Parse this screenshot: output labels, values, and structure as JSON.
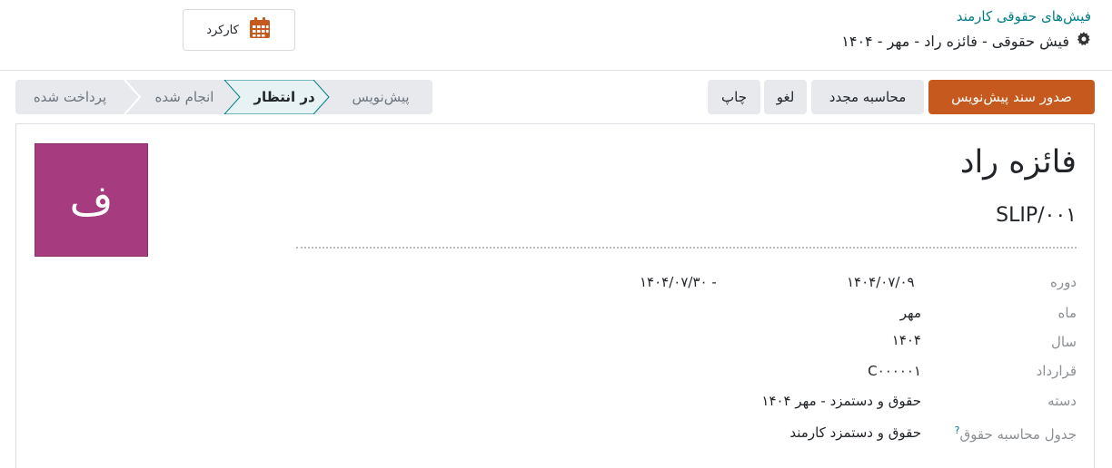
{
  "header": {
    "breadcrumb": "فیش‌های حقوقی کارمند",
    "title": "فیش حقوقی - فائزه راد - مهر - ۱۴۰۴",
    "gear_icon": "gear-icon",
    "worked_days_button": {
      "label": "کارکرد",
      "icon": "calendar-icon",
      "icon_color": "#c65a1e"
    }
  },
  "actions": {
    "create_draft_entry": "صدور سند پیش‌نویس",
    "recompute": "محاسبه مجدد",
    "cancel": "لغو",
    "print": "چاپ"
  },
  "status": {
    "steps": [
      "پیش‌نویس",
      "در انتظار",
      "انجام شده",
      "پرداخت شده"
    ],
    "active": "در انتظار"
  },
  "sheet": {
    "avatar_letter": "ف",
    "avatar_color": "#a63c7f",
    "employee_name": "فائزه راد",
    "reference": "SLIP/۰۰۱",
    "fields": {
      "period": {
        "label": "دوره",
        "from": "۱۴۰۴/۰۷/۰۹",
        "to": "- ۱۴۰۴/۰۷/۳۰"
      },
      "month": {
        "label": "ماه",
        "value": "مهر"
      },
      "year": {
        "label": "سال",
        "value": "۱۴۰۴"
      },
      "contract": {
        "label": "قرارداد",
        "value": "C۰۰۰۰۰۱"
      },
      "batch": {
        "label": "دسته",
        "value": "حقوق و دستمزد - مهر ۱۴۰۴"
      },
      "structure": {
        "label": "جدول محاسبه حقوق",
        "help": "?",
        "value": "حقوق و دستمزد کارمند"
      }
    }
  },
  "colors": {
    "accent": "#017e84",
    "primary": "#c65a1e",
    "secondary": "#e7e9ed"
  }
}
